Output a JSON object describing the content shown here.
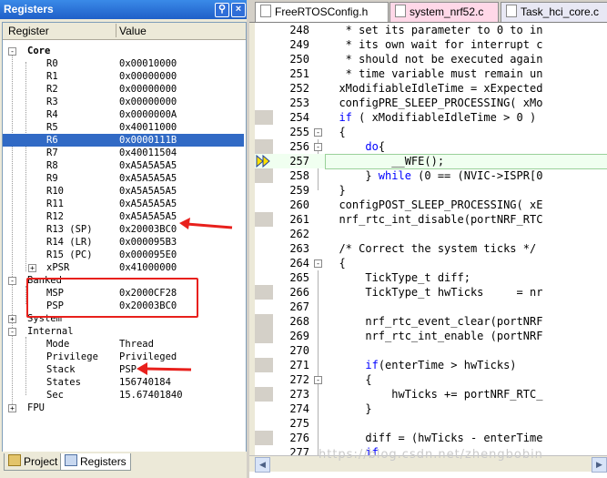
{
  "registers_panel": {
    "title": "Registers",
    "columns": {
      "name": "Register",
      "value": "Value"
    },
    "rows": [
      {
        "name": "Core",
        "value": ""
      },
      {
        "name": "R0",
        "value": "0x00010000"
      },
      {
        "name": "R1",
        "value": "0x00000000"
      },
      {
        "name": "R2",
        "value": "0x00000000"
      },
      {
        "name": "R3",
        "value": "0x00000000"
      },
      {
        "name": "R4",
        "value": "0x0000000A"
      },
      {
        "name": "R5",
        "value": "0x40011000"
      },
      {
        "name": "R6",
        "value": "0x0000111B"
      },
      {
        "name": "R7",
        "value": "0x40011504"
      },
      {
        "name": "R8",
        "value": "0xA5A5A5A5"
      },
      {
        "name": "R9",
        "value": "0xA5A5A5A5"
      },
      {
        "name": "R10",
        "value": "0xA5A5A5A5"
      },
      {
        "name": "R11",
        "value": "0xA5A5A5A5"
      },
      {
        "name": "R12",
        "value": "0xA5A5A5A5"
      },
      {
        "name": "R13 (SP)",
        "value": "0x20003BC0"
      },
      {
        "name": "R14 (LR)",
        "value": "0x000095B3"
      },
      {
        "name": "R15 (PC)",
        "value": "0x000095E0"
      },
      {
        "name": "xPSR",
        "value": "0x41000000"
      },
      {
        "name": "Banked",
        "value": ""
      },
      {
        "name": "MSP",
        "value": "0x2000CF28"
      },
      {
        "name": "PSP",
        "value": "0x20003BC0"
      },
      {
        "name": "System",
        "value": ""
      },
      {
        "name": "Internal",
        "value": ""
      },
      {
        "name": "Mode",
        "value": "Thread"
      },
      {
        "name": "Privilege",
        "value": "Privileged"
      },
      {
        "name": "Stack",
        "value": "PSP"
      },
      {
        "name": "States",
        "value": "156740184"
      },
      {
        "name": "Sec",
        "value": "15.67401840"
      },
      {
        "name": "FPU",
        "value": ""
      }
    ],
    "tabs": [
      {
        "label": "Project"
      },
      {
        "label": "Registers"
      }
    ]
  },
  "editor": {
    "tabs": [
      {
        "label": "FreeRTOSConfig.h"
      },
      {
        "label": "system_nrf52.c"
      },
      {
        "label": "Task_hci_core.c"
      }
    ],
    "lines": [
      {
        "num": "248",
        "code": "   * set its parameter to 0 to in"
      },
      {
        "num": "249",
        "code": "   * its own wait for interrupt c"
      },
      {
        "num": "250",
        "code": "   * should not be executed again"
      },
      {
        "num": "251",
        "code": "   * time variable must remain un"
      },
      {
        "num": "252",
        "code": "  xModifiableIdleTime = xExpected"
      },
      {
        "num": "253",
        "code": "  configPRE_SLEEP_PROCESSING( xMo"
      },
      {
        "num": "254",
        "code": "  if ( xModifiableIdleTime > 0 )"
      },
      {
        "num": "255",
        "code": "  {"
      },
      {
        "num": "256",
        "code": "      do{"
      },
      {
        "num": "257",
        "code": "          __WFE();"
      },
      {
        "num": "258",
        "code": "      } while (0 == (NVIC->ISPR[0"
      },
      {
        "num": "259",
        "code": "  }"
      },
      {
        "num": "260",
        "code": "  configPOST_SLEEP_PROCESSING( xE"
      },
      {
        "num": "261",
        "code": "  nrf_rtc_int_disable(portNRF_RTC"
      },
      {
        "num": "262",
        "code": ""
      },
      {
        "num": "263",
        "code": "  /* Correct the system ticks */"
      },
      {
        "num": "264",
        "code": "  {"
      },
      {
        "num": "265",
        "code": "      TickType_t diff;"
      },
      {
        "num": "266",
        "code": "      TickType_t hwTicks     = nr"
      },
      {
        "num": "267",
        "code": ""
      },
      {
        "num": "268",
        "code": "      nrf_rtc_event_clear(portNRF"
      },
      {
        "num": "269",
        "code": "      nrf_rtc_int_enable (portNRF"
      },
      {
        "num": "270",
        "code": ""
      },
      {
        "num": "271",
        "code": "      if(enterTime > hwTicks)"
      },
      {
        "num": "272",
        "code": "      {"
      },
      {
        "num": "273",
        "code": "          hwTicks += portNRF_RTC_"
      },
      {
        "num": "274",
        "code": "      }"
      },
      {
        "num": "275",
        "code": ""
      },
      {
        "num": "276",
        "code": "      diff = (hwTicks - enterTime"
      },
      {
        "num": "277",
        "code": "      if"
      }
    ],
    "watermark": "https://blog.csdn.net/zhengbobin"
  },
  "colors": {
    "selection": "#316ac5",
    "annotation_red": "#e8201c",
    "comment": "#008000",
    "keyword": "#0000ff"
  }
}
